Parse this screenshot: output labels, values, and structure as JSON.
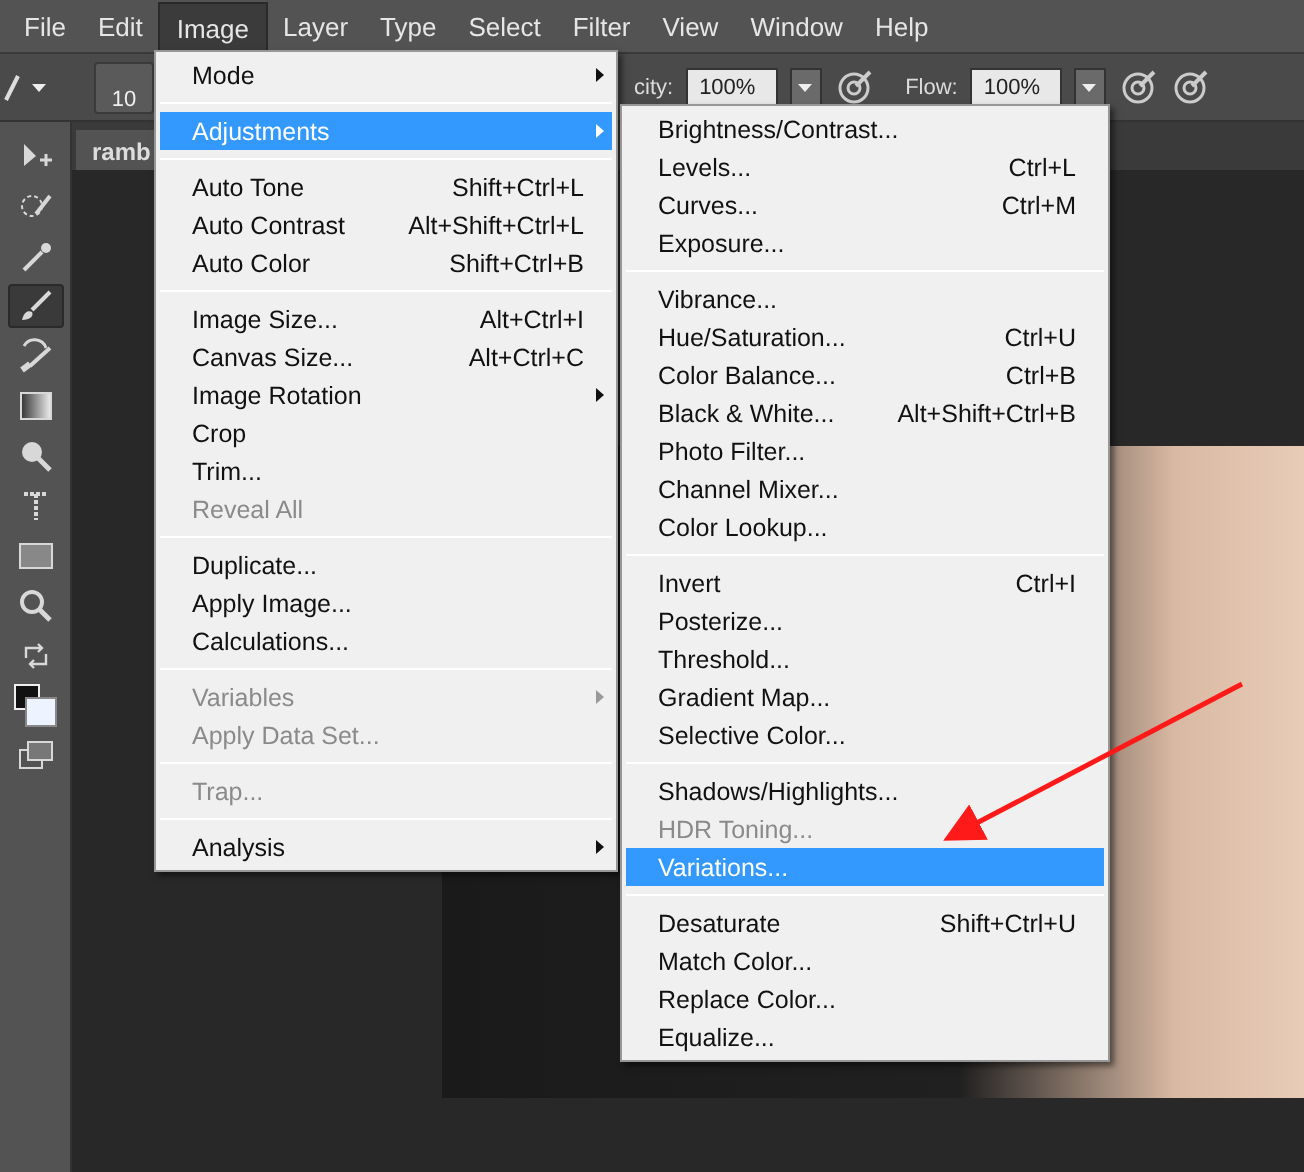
{
  "menubar": [
    {
      "label": "File",
      "selected": false
    },
    {
      "label": "Edit",
      "selected": false
    },
    {
      "label": "Image",
      "selected": true
    },
    {
      "label": "Layer",
      "selected": false
    },
    {
      "label": "Type",
      "selected": false
    },
    {
      "label": "Select",
      "selected": false
    },
    {
      "label": "Filter",
      "selected": false
    },
    {
      "label": "View",
      "selected": false
    },
    {
      "label": "Window",
      "selected": false
    },
    {
      "label": "Help",
      "selected": false
    }
  ],
  "options_bar": {
    "brush_size": "10",
    "opacity_label": "city:",
    "opacity": "100%",
    "flow_label": "Flow:",
    "flow": "100%"
  },
  "document_tab": {
    "label": "ramb"
  },
  "tools": [
    {
      "kind": "move",
      "selected": false
    },
    {
      "kind": "quick-select",
      "selected": false
    },
    {
      "kind": "eyedropper",
      "selected": false
    },
    {
      "kind": "brush",
      "selected": true
    },
    {
      "kind": "history-brush",
      "selected": false
    },
    {
      "kind": "gradient",
      "selected": false
    },
    {
      "kind": "dodge",
      "selected": false
    },
    {
      "kind": "type",
      "selected": false
    },
    {
      "kind": "rectangle",
      "selected": false
    },
    {
      "kind": "zoom",
      "selected": false
    },
    {
      "kind": "swap",
      "selected": false
    },
    {
      "kind": "colors",
      "selected": false
    },
    {
      "kind": "screen-mode",
      "selected": false
    }
  ],
  "image_menu": [
    {
      "kind": "item",
      "label": "Mode",
      "submenu": true,
      "selected": false,
      "disabled": false
    },
    {
      "kind": "separator"
    },
    {
      "kind": "item",
      "label": "Adjustments",
      "submenu": true,
      "selected": true,
      "disabled": false
    },
    {
      "kind": "separator"
    },
    {
      "kind": "item",
      "label": "Auto Tone",
      "shortcut": "Shift+Ctrl+L",
      "submenu": false,
      "selected": false,
      "disabled": false
    },
    {
      "kind": "item",
      "label": "Auto Contrast",
      "shortcut": "Alt+Shift+Ctrl+L",
      "submenu": false,
      "selected": false,
      "disabled": false
    },
    {
      "kind": "item",
      "label": "Auto Color",
      "shortcut": "Shift+Ctrl+B",
      "submenu": false,
      "selected": false,
      "disabled": false
    },
    {
      "kind": "separator"
    },
    {
      "kind": "item",
      "label": "Image Size...",
      "shortcut": "Alt+Ctrl+I",
      "submenu": false,
      "selected": false,
      "disabled": false
    },
    {
      "kind": "item",
      "label": "Canvas Size...",
      "shortcut": "Alt+Ctrl+C",
      "submenu": false,
      "selected": false,
      "disabled": false
    },
    {
      "kind": "item",
      "label": "Image Rotation",
      "submenu": true,
      "selected": false,
      "disabled": false
    },
    {
      "kind": "item",
      "label": "Crop",
      "submenu": false,
      "selected": false,
      "disabled": false
    },
    {
      "kind": "item",
      "label": "Trim...",
      "submenu": false,
      "selected": false,
      "disabled": false
    },
    {
      "kind": "item",
      "label": "Reveal All",
      "submenu": false,
      "selected": false,
      "disabled": true
    },
    {
      "kind": "separator"
    },
    {
      "kind": "item",
      "label": "Duplicate...",
      "submenu": false,
      "selected": false,
      "disabled": false
    },
    {
      "kind": "item",
      "label": "Apply Image...",
      "submenu": false,
      "selected": false,
      "disabled": false
    },
    {
      "kind": "item",
      "label": "Calculations...",
      "submenu": false,
      "selected": false,
      "disabled": false
    },
    {
      "kind": "separator"
    },
    {
      "kind": "item",
      "label": "Variables",
      "submenu": true,
      "selected": false,
      "disabled": true
    },
    {
      "kind": "item",
      "label": "Apply Data Set...",
      "submenu": false,
      "selected": false,
      "disabled": true
    },
    {
      "kind": "separator"
    },
    {
      "kind": "item",
      "label": "Trap...",
      "submenu": false,
      "selected": false,
      "disabled": true
    },
    {
      "kind": "separator"
    },
    {
      "kind": "item",
      "label": "Analysis",
      "submenu": true,
      "selected": false,
      "disabled": false
    }
  ],
  "adjustments_menu": [
    {
      "kind": "item",
      "label": "Brightness/Contrast...",
      "selected": false,
      "disabled": false
    },
    {
      "kind": "item",
      "label": "Levels...",
      "shortcut": "Ctrl+L",
      "selected": false,
      "disabled": false
    },
    {
      "kind": "item",
      "label": "Curves...",
      "shortcut": "Ctrl+M",
      "selected": false,
      "disabled": false
    },
    {
      "kind": "item",
      "label": "Exposure...",
      "selected": false,
      "disabled": false
    },
    {
      "kind": "separator"
    },
    {
      "kind": "item",
      "label": "Vibrance...",
      "selected": false,
      "disabled": false
    },
    {
      "kind": "item",
      "label": "Hue/Saturation...",
      "shortcut": "Ctrl+U",
      "selected": false,
      "disabled": false
    },
    {
      "kind": "item",
      "label": "Color Balance...",
      "shortcut": "Ctrl+B",
      "selected": false,
      "disabled": false
    },
    {
      "kind": "item",
      "label": "Black & White...",
      "shortcut": "Alt+Shift+Ctrl+B",
      "selected": false,
      "disabled": false
    },
    {
      "kind": "item",
      "label": "Photo Filter...",
      "selected": false,
      "disabled": false
    },
    {
      "kind": "item",
      "label": "Channel Mixer...",
      "selected": false,
      "disabled": false
    },
    {
      "kind": "item",
      "label": "Color Lookup...",
      "selected": false,
      "disabled": false
    },
    {
      "kind": "separator"
    },
    {
      "kind": "item",
      "label": "Invert",
      "shortcut": "Ctrl+I",
      "selected": false,
      "disabled": false
    },
    {
      "kind": "item",
      "label": "Posterize...",
      "selected": false,
      "disabled": false
    },
    {
      "kind": "item",
      "label": "Threshold...",
      "selected": false,
      "disabled": false
    },
    {
      "kind": "item",
      "label": "Gradient Map...",
      "selected": false,
      "disabled": false
    },
    {
      "kind": "item",
      "label": "Selective Color...",
      "selected": false,
      "disabled": false
    },
    {
      "kind": "separator"
    },
    {
      "kind": "item",
      "label": "Shadows/Highlights...",
      "selected": false,
      "disabled": false
    },
    {
      "kind": "item",
      "label": "HDR Toning...",
      "selected": false,
      "disabled": true
    },
    {
      "kind": "item",
      "label": "Variations...",
      "selected": true,
      "disabled": false
    },
    {
      "kind": "separator"
    },
    {
      "kind": "item",
      "label": "Desaturate",
      "shortcut": "Shift+Ctrl+U",
      "selected": false,
      "disabled": false
    },
    {
      "kind": "item",
      "label": "Match Color...",
      "selected": false,
      "disabled": false
    },
    {
      "kind": "item",
      "label": "Replace Color...",
      "selected": false,
      "disabled": false
    },
    {
      "kind": "item",
      "label": "Equalize...",
      "selected": false,
      "disabled": false
    }
  ]
}
